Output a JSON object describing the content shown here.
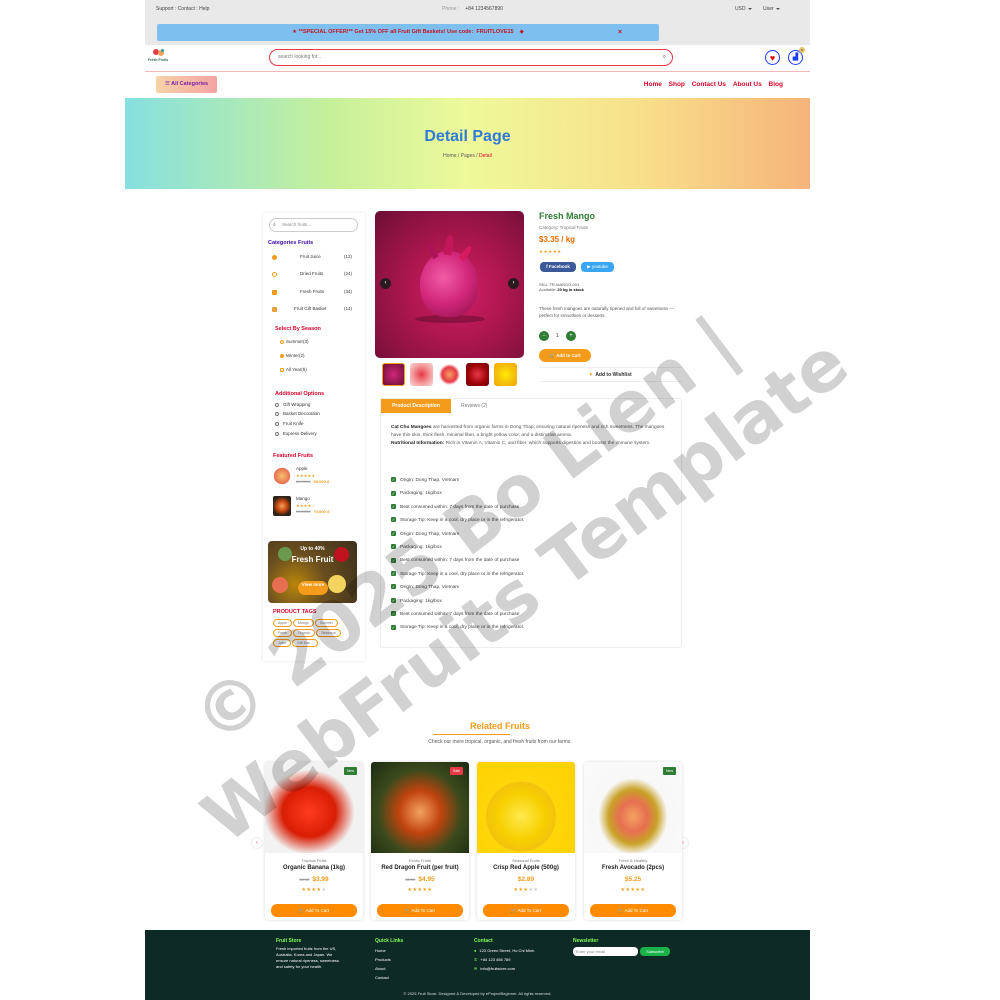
{
  "topbar": {
    "links": "Support : Contact : Help",
    "phone_label": "Phone :",
    "phone": "+84 1234567890",
    "currency": "USD",
    "user": "User"
  },
  "offer": {
    "text": "**SPECIAL OFFER!** Get 15% OFF all Fruit Gift Baskets! Use code:",
    "code": "FRUITLOVE15",
    "close": "×"
  },
  "header": {
    "logo_text": "Fresh Fruits",
    "search_placeholder": "search looking for...",
    "cart_count": "0"
  },
  "nav": {
    "all_categories": "☰ All Categories",
    "links": [
      "Home",
      "Shop",
      "Contact Us",
      "About Us",
      "Blog"
    ]
  },
  "hero": {
    "title": "Detail Page",
    "crumb_home": "Home",
    "crumb_pages": "Pages",
    "crumb_current": "Detail"
  },
  "sidebar": {
    "search_placeholder": "Search fruits...",
    "categories_title": "Categories Fruits",
    "categories": [
      {
        "name": "Fruit Juice",
        "count": "(12)"
      },
      {
        "name": "Dried Fruits",
        "count": "(24)"
      },
      {
        "name": "Fresh Fruits",
        "count": "(34)"
      },
      {
        "name": "Fruit Gift Basket",
        "count": "(14)"
      }
    ],
    "season_title": "Select By Season",
    "seasons": [
      "Summer(3)",
      "Winter(2)",
      "All Year(5)"
    ],
    "options_title": "Additional Options",
    "options": [
      "Gift Wrapping",
      "Basket Decoration",
      "Fruit Knife",
      "Express Delivery"
    ],
    "featured_title": "Featured Fruits",
    "featured": [
      {
        "name": "Apple",
        "stars": "★★★★★",
        "old": "80.000đ",
        "price": "50.000 đ"
      },
      {
        "name": "Mango",
        "stars": "★★★★☆",
        "old": "90.000đ",
        "price": "70.000 đ"
      }
    ],
    "promo_discount": "Up to 40%",
    "promo_title": "Fresh Fruit",
    "promo_button": "View more",
    "tags_title": "PRODUCT TAGS",
    "tags": [
      "Apple",
      "Mango",
      "Summer",
      "Fresh",
      "Organic",
      "Seasonal",
      "Juice",
      "Gift Bas..."
    ]
  },
  "product": {
    "title": "Fresh Mango",
    "category": "Category: Tropical Fruits",
    "price": "$3.35 / kg",
    "stars": "★★★★★",
    "facebook": "f Facebook",
    "youtube": "▶ youtube",
    "sku": "SKU: FR-MANGO-001",
    "available_label": "Available:",
    "available_value": "20 kg in stock",
    "description": "These fresh mangoes are naturally ripened and full of sweetness — perfect for smoothies or desserts.",
    "qty": "1",
    "add_to_cart": "🛒 Add to Cart",
    "add_to_wishlist": "Add to Wishlist"
  },
  "tabs": {
    "tab1": "Product Description",
    "tab2": "Reviews (2)",
    "intro_bold": "Cat Chu Mangoes",
    "intro_text": " are harvested from organic farms in Dong Thap, ensuring natural ripeness and rich sweetness. The mangoes have thin skin, thick flesh, minimal fiber, a bright yellow color, and a distinctive aroma.",
    "nutri_bold": "Nutritional Information:",
    "nutri_text": " Rich in Vitamin A, Vitamin C, and fiber, which supports digestion and boosts the immune system.",
    "features": [
      "Origin: Dong Thap, Vietnam",
      "Packaging: 1kg/box",
      "Best consumed within: 7 days from the date of purchase",
      "Storage Tip: Keep in a cool, dry place or in the refrigerator.",
      "Origin: Dong Thap, Vietnam",
      "Packaging: 1kg/box",
      "Best consumed within: 7 days from the date of purchase",
      "Storage Tip: Keep in a cool, dry place or in the refrigerator.",
      "Origin: Dong Thap, Vietnam",
      "Packaging: 1kg/box",
      "Best consumed within: 7 days from the date of purchase",
      "Storage Tip: Keep in a cool, dry place or in the refrigerator."
    ]
  },
  "related": {
    "title": "Related Fruits",
    "subtitle": "Check our more tropical, organic, and fresh fruits from our farms.",
    "items": [
      {
        "badge": "New",
        "category": "Tropical Fruits",
        "name": "Organic Banana (1kg)",
        "old": "$4.50",
        "price": "$3.99",
        "stars": "★★★★",
        "empty": "★",
        "button": "🛒 Add To Cart"
      },
      {
        "badge": "Sale",
        "category": "Exotic Fruits",
        "name": "Red Dragon Fruit (per fruit)",
        "old": "$5.50",
        "price": "$4.95",
        "stars": "★★★★★",
        "empty": "",
        "button": "🛒 Add To Cart"
      },
      {
        "badge": "",
        "category": "Seasonal Fruits",
        "name": "Crisp Red Apple (500g)",
        "old": "",
        "price": "$2.89",
        "stars": "★★★",
        "empty": "★★",
        "button": "🛒 Add To Cart"
      },
      {
        "badge": "New",
        "category": "Fresh & Healthy",
        "name": "Fresh Avocado (2pcs)",
        "old": "",
        "price": "$5.25",
        "stars": "★★★★★",
        "empty": "",
        "button": "🛒 Add To Cart"
      }
    ]
  },
  "footer": {
    "store_title": "Fruit Store",
    "store_text": "Fresh imported fruits from the US, Australia, Korea and Japan. We ensure natural ripeness, sweetness and safety for your health.",
    "quick_title": "Quick Links",
    "quick_links": [
      "Home",
      "Products",
      "About",
      "Contact"
    ],
    "contact_title": "Contact",
    "address": "123 Green Street, Ho Chi Minh",
    "phone": "+84 123 456 789",
    "email": "info@fruitstore.com",
    "newsletter_title": "Newsletter",
    "email_placeholder": "Enter your email",
    "subscribe": "Subscribe",
    "copyright": "© 2025 Fruit Store. Designed & Developed by eProjectBeginner. All rights reserved."
  },
  "watermark": "© 2025 Bo Lien |\nWebFruits Template"
}
